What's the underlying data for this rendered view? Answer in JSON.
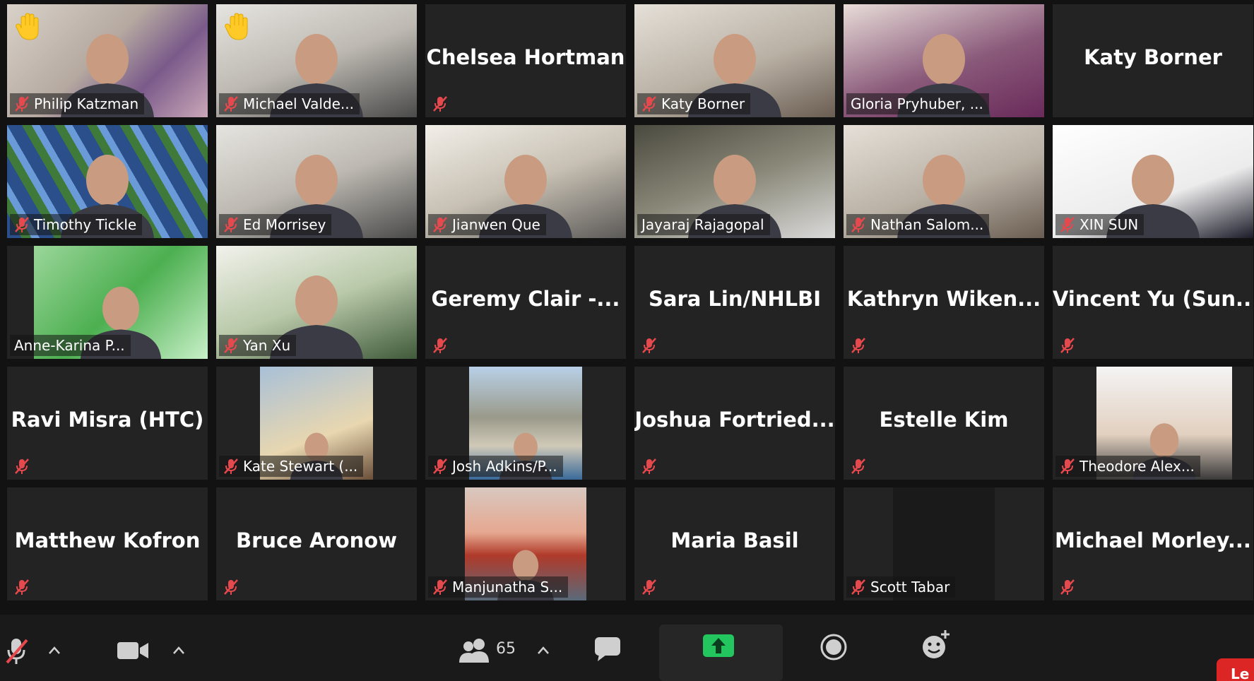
{
  "app": {
    "name": "Zoom Meeting",
    "theme": "dark"
  },
  "participants": [
    {
      "name": "Philip Katzman",
      "video": true,
      "muted": true,
      "hand_raised": true,
      "speaking": false,
      "bg": "photo-mug"
    },
    {
      "name": "Michael Valde...",
      "video": true,
      "muted": true,
      "hand_raised": true,
      "speaking": false,
      "bg": "photo-office"
    },
    {
      "name": "Chelsea Hortman",
      "video": false,
      "muted": true,
      "hand_raised": false,
      "speaking": false
    },
    {
      "name": "Katy Borner",
      "video": true,
      "muted": true,
      "hand_raised": false,
      "speaking": false,
      "bg": "photo-room"
    },
    {
      "name": "Gloria Pryhuber, ...",
      "video": true,
      "muted": false,
      "hand_raised": false,
      "speaking": true,
      "bg": "photo-purple"
    },
    {
      "name": "Katy Borner",
      "video": false,
      "muted": false,
      "hand_raised": false,
      "speaking": false
    },
    {
      "name": "Timothy Tickle",
      "video": true,
      "muted": true,
      "hand_raised": false,
      "speaking": false,
      "bg": "photo-irises"
    },
    {
      "name": "Ed Morrisey",
      "video": true,
      "muted": true,
      "hand_raised": false,
      "speaking": false,
      "bg": "photo-office"
    },
    {
      "name": "Jianwen Que",
      "video": true,
      "muted": true,
      "hand_raised": false,
      "speaking": false,
      "bg": "photo-kitchen"
    },
    {
      "name": "Jayaraj Rajagopal",
      "video": true,
      "muted": false,
      "hand_raised": false,
      "speaking": false,
      "bg": "photo-dim"
    },
    {
      "name": "Nathan Salom...",
      "video": true,
      "muted": true,
      "hand_raised": false,
      "speaking": false,
      "bg": "photo-room"
    },
    {
      "name": "XIN SUN",
      "video": true,
      "muted": true,
      "hand_raised": false,
      "speaking": false,
      "bg": "photo-white"
    },
    {
      "name": "Anne-Karina P...",
      "video": true,
      "muted": false,
      "hand_raised": false,
      "speaking": false,
      "bg": "photo-green"
    },
    {
      "name": "Yan Xu",
      "video": true,
      "muted": true,
      "hand_raised": false,
      "speaking": false,
      "bg": "photo-blossom"
    },
    {
      "name": "Geremy Clair -...",
      "video": false,
      "muted": true,
      "hand_raised": false,
      "speaking": false
    },
    {
      "name": "Sara Lin/NHLBI",
      "video": false,
      "muted": true,
      "hand_raised": false,
      "speaking": false
    },
    {
      "name": "Kathryn  Wiken...",
      "video": false,
      "muted": true,
      "hand_raised": false,
      "speaking": false
    },
    {
      "name": "Vincent  Yu  (Sun...",
      "video": false,
      "muted": true,
      "hand_raised": false,
      "speaking": false
    },
    {
      "name": "Ravi Misra (HTC)",
      "video": false,
      "muted": true,
      "hand_raised": false,
      "speaking": false
    },
    {
      "name": "Kate Stewart (...",
      "video": true,
      "muted": true,
      "hand_raised": false,
      "speaking": false,
      "bg": "photo-portrait-blond"
    },
    {
      "name": "Josh Adkins/P...",
      "video": true,
      "muted": true,
      "hand_raised": false,
      "speaking": false,
      "bg": "photo-beach"
    },
    {
      "name": "Joshua  Fortried...",
      "video": false,
      "muted": true,
      "hand_raised": false,
      "speaking": false
    },
    {
      "name": "Estelle Kim",
      "video": false,
      "muted": true,
      "hand_raised": false,
      "speaking": false
    },
    {
      "name": "Theodore Alex...",
      "video": true,
      "muted": true,
      "hand_raised": false,
      "speaking": false,
      "bg": "photo-portrait-white"
    },
    {
      "name": "Matthew Kofron",
      "video": false,
      "muted": true,
      "hand_raised": false,
      "speaking": false
    },
    {
      "name": "Bruce Aronow",
      "video": false,
      "muted": true,
      "hand_raised": false,
      "speaking": false
    },
    {
      "name": "Manjunatha S...",
      "video": true,
      "muted": true,
      "hand_raised": false,
      "speaking": false,
      "bg": "photo-bridge"
    },
    {
      "name": "Maria Basil",
      "video": false,
      "muted": true,
      "hand_raised": false,
      "speaking": false
    },
    {
      "name": "Scott Tabar",
      "video": true,
      "muted": true,
      "hand_raised": false,
      "speaking": false,
      "bg": "photo-black"
    },
    {
      "name": "Michael  Morley...",
      "video": false,
      "muted": true,
      "hand_raised": false,
      "speaking": false
    }
  ],
  "toolbar": {
    "mute_icon": "microphone-muted-icon",
    "video_icon": "video-camera-icon",
    "participants_icon": "participants-icon",
    "participant_count": "65",
    "chat_icon": "chat-icon",
    "share_icon": "share-screen-icon",
    "record_icon": "record-icon",
    "reactions_icon": "reactions-icon",
    "leave_label": "Le"
  },
  "colors": {
    "speaking_border": "#c8e04a",
    "muted_icon": "#e5484d",
    "share": "#22c55e",
    "leave": "#dc2626"
  }
}
